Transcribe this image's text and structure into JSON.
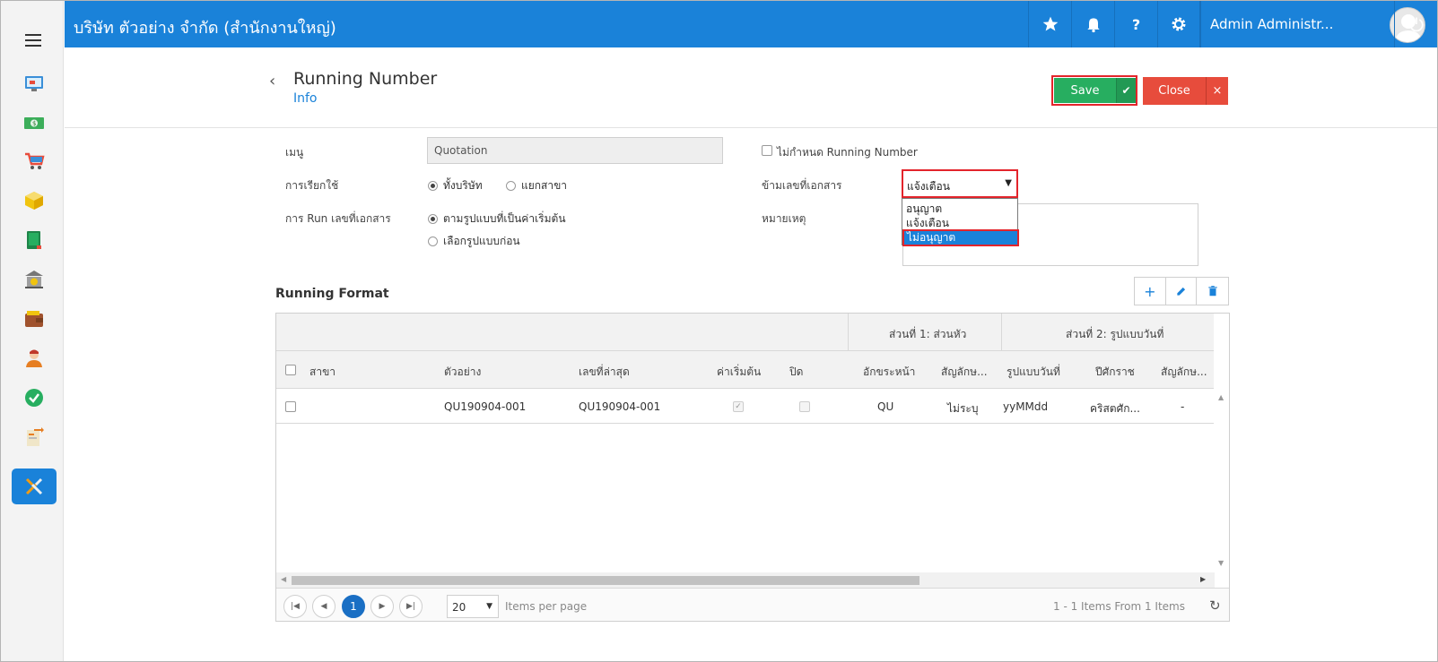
{
  "topbar": {
    "company": "บริษัท ตัวอย่าง จำกัด (สำนักงานใหญ่)",
    "user_name": "Admin Administr..."
  },
  "header": {
    "title": "Running Number",
    "subtitle": "Info",
    "save_label": "Save",
    "close_label": "Close"
  },
  "form": {
    "menu_label": "เมนู",
    "menu_value": "Quotation",
    "usage_label": "การเรียกใช้",
    "usage_options": [
      "ทั้งบริษัท",
      "แยกสาขา"
    ],
    "run_label": "การ Run เลขที่เอกสาร",
    "run_options": [
      "ตามรูปแบบที่เป็นค่าเริ่มต้น",
      "เลือกรูปแบบก่อน"
    ],
    "no_running_label": "ไม่กำหนด Running Number",
    "skip_label": "ข้ามเลขที่เอกสาร",
    "skip_value": "แจ้งเตือน",
    "skip_options": [
      "อนุญาต",
      "แจ้งเตือน",
      "ไม่อนุญาต"
    ],
    "remark_label": "หมายเหตุ"
  },
  "section": {
    "title": "Running Format"
  },
  "grid": {
    "group_headers": [
      "ส่วนที่ 1: ส่วนหัว",
      "ส่วนที่ 2: รูปแบบวันที่"
    ],
    "columns": [
      "สาขา",
      "ตัวอย่าง",
      "เลขที่ล่าสุด",
      "ค่าเริ่มต้น",
      "ปิด",
      "อักขระหน้า",
      "สัญลักษ...",
      "รูปแบบวันที่",
      "ปีศักราช",
      "สัญลักษ..."
    ],
    "rows": [
      {
        "branch": "",
        "example": "QU190904-001",
        "latest": "QU190904-001",
        "default_checked": true,
        "closed_checked": false,
        "prefix": "QU",
        "symbol": "ไม่ระบุ",
        "date_format": "yyMMdd",
        "era": "คริสตศัก...",
        "symbol2": "-"
      }
    ]
  },
  "pager": {
    "current_page": "1",
    "page_size": "20",
    "items_per_page": "Items per page",
    "summary": "1 - 1 Items From 1 Items"
  }
}
